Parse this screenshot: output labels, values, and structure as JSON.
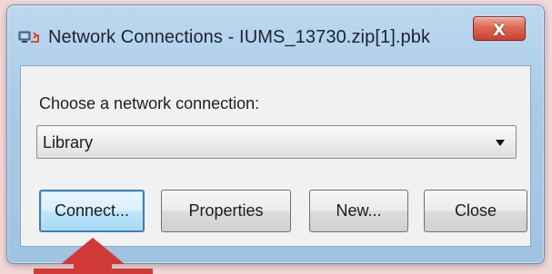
{
  "window": {
    "title": "Network Connections - IUMS_13730.zip[1].pbk",
    "close_glyph": "X",
    "icon": "network-connections-icon"
  },
  "dialog": {
    "prompt": "Choose a network connection:",
    "selected_connection": "Library"
  },
  "buttons": {
    "connect": "Connect...",
    "properties": "Properties",
    "new": "New...",
    "close": "Close"
  },
  "annotation": {
    "arrow_color": "#cf3a36",
    "points_to": "connect-button"
  }
}
